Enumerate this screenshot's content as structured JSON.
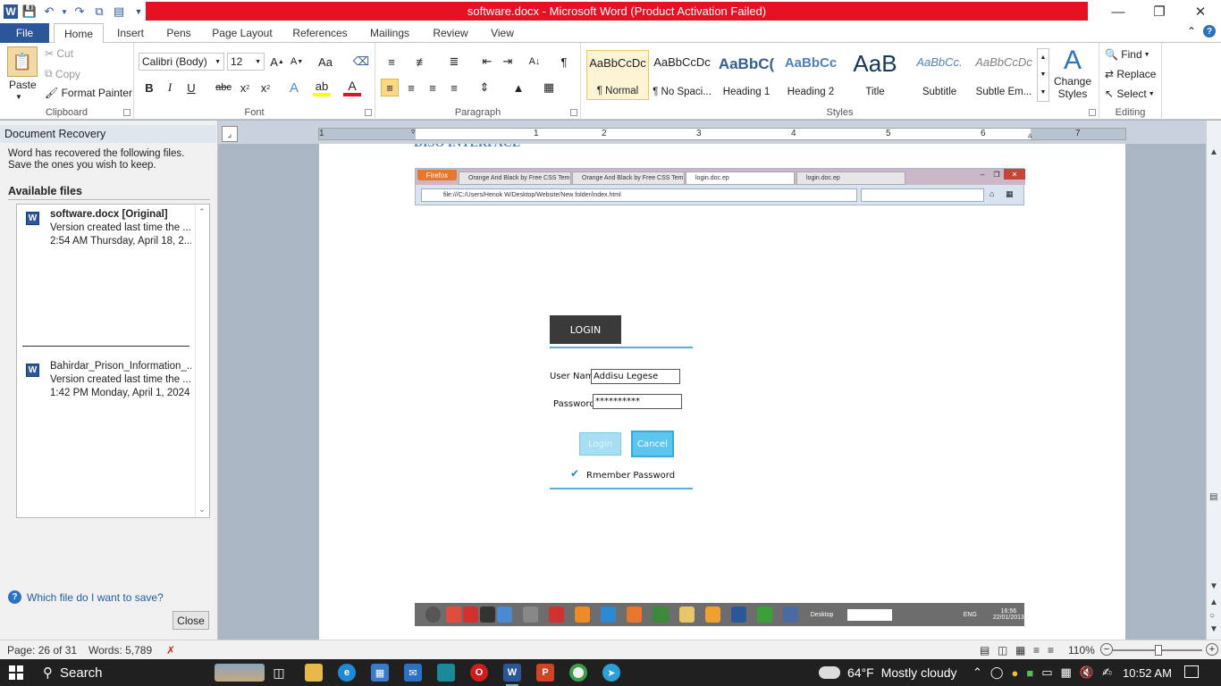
{
  "window": {
    "title": "software.docx  -  Microsoft Word (Product Activation Failed)",
    "app_logo": "W"
  },
  "tabs": [
    "File",
    "Home",
    "Insert",
    "Pens",
    "Page Layout",
    "References",
    "Mailings",
    "Review",
    "View"
  ],
  "ribbon": {
    "clipboard": {
      "paste": "Paste",
      "cut": "Cut",
      "copy": "Copy",
      "format_painter": "Format Painter",
      "label": "Clipboard"
    },
    "font": {
      "name": "Calibri (Body)",
      "size": "12",
      "label": "Font"
    },
    "paragraph": {
      "label": "Paragraph"
    },
    "styles": {
      "label": "Styles",
      "items": [
        {
          "sample": "AaBbCcDc",
          "name": "¶ Normal"
        },
        {
          "sample": "AaBbCcDc",
          "name": "¶ No Spaci..."
        },
        {
          "sample": "AaBbC(",
          "name": "Heading 1"
        },
        {
          "sample": "AaBbCc",
          "name": "Heading 2"
        },
        {
          "sample": "AaB",
          "name": "Title"
        },
        {
          "sample": "AaBbCc.",
          "name": "Subtitle"
        },
        {
          "sample": "AaBbCcDc",
          "name": "Subtle Em..."
        }
      ],
      "change_styles": [
        "Change",
        "Styles"
      ]
    },
    "editing": {
      "find": "Find",
      "replace": "Replace",
      "select": "Select",
      "label": "Editing"
    }
  },
  "ruler": {
    "numbers": [
      "1",
      "1",
      "2",
      "3",
      "4",
      "5",
      "6",
      "7"
    ]
  },
  "recovery": {
    "title": "Document Recovery",
    "description": "Word has recovered the following files.  Save the ones you wish to keep.",
    "available": "Available files",
    "files": [
      {
        "name": "software.docx  [Original]",
        "line2": "Version created last time the ...",
        "line3": "2:54 AM Thursday, April 18, 2..."
      },
      {
        "name": "Bahirdar_Prison_Information_...",
        "line2": "Version created last time the ...",
        "line3": "1:42 PM Monday, April 1, 2024"
      }
    ],
    "help_link": "Which file do I want to save?",
    "close": "Close"
  },
  "document": {
    "heading_fragment": "DISO INTERFACE",
    "embedded": {
      "browser_button": "Firefox",
      "tabs": [
        "Orange And Black by Free CSS Templ...",
        "Orange And Black by Free CSS Templ...",
        "login.doc.ep",
        "login.doc.ep"
      ],
      "url": "file:///C:/Users/Henok W/Desktop/Website/New folder/index.html",
      "login_title": "LOGIN",
      "username_label": "User Name",
      "username_value": "Addisu Legese",
      "password_label": "Password",
      "password_value": "**********",
      "login_button": "Login",
      "cancel_button": "Cancel",
      "remember": "Rmember Password",
      "taskbar_label": "Desktop",
      "taskbar_lang": "ENG",
      "taskbar_time": "16:56",
      "taskbar_date": "22/01/2013"
    }
  },
  "status": {
    "page": "Page: 26 of 31",
    "words": "Words: 5,789",
    "zoom": "110%",
    "zoom_percent": 110
  },
  "taskbar": {
    "search": "Search",
    "weather_temp": "64°F",
    "weather_desc": "Mostly cloudy",
    "time": "10:52 AM"
  },
  "colors": {
    "accent": "#2b579a",
    "title_error": "#e81123"
  }
}
